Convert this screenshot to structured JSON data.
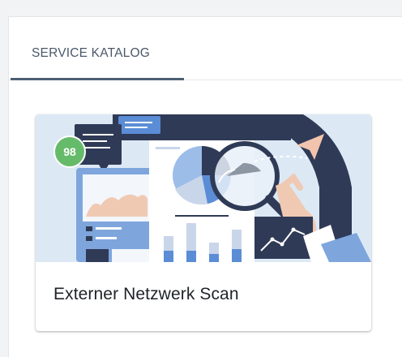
{
  "header": {
    "tab_label": "SERVICE KATALOG"
  },
  "card": {
    "title": "Externer Netzwerk Scan",
    "score": "98"
  },
  "colors": {
    "tab_underline": "#4d5f72",
    "badge": "#66bb6a",
    "illustration_bg": "#dce9f5",
    "illustration_navy": "#2f3a56",
    "illustration_blue": "#5b8dd6"
  },
  "icons": {
    "illustration": "data-analysis-illustration"
  }
}
